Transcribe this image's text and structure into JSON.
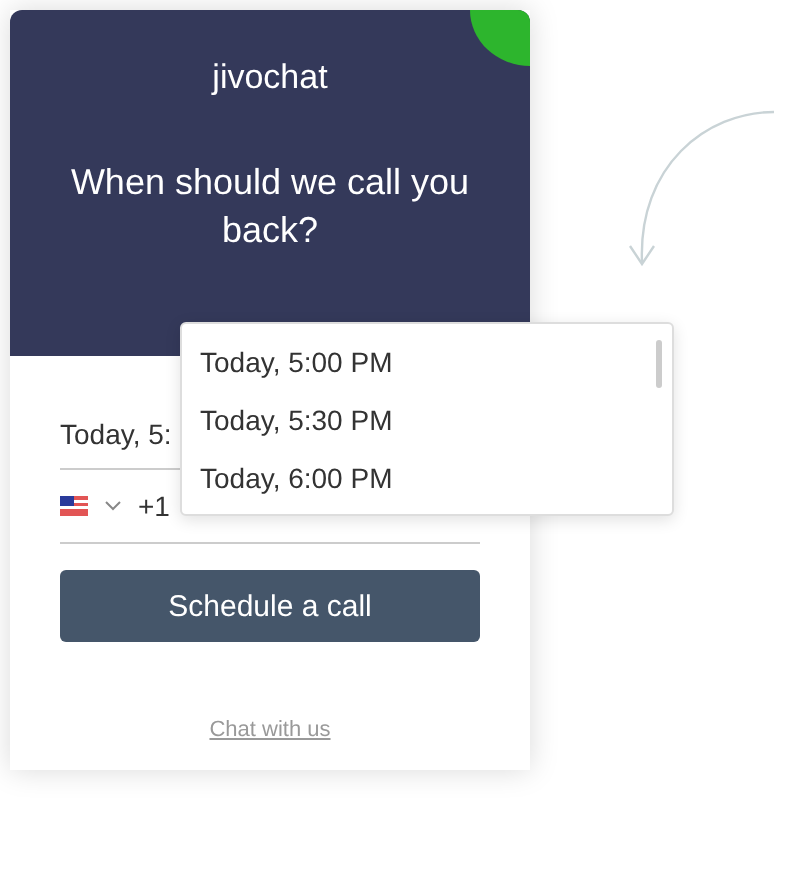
{
  "widget": {
    "logo": "jivochat",
    "heading": "When should we call you back?",
    "date_field": {
      "value": "Today, 5:"
    },
    "phone_field": {
      "code": "+1"
    },
    "submit_button": "Schedule a call",
    "link": "Chat with us"
  },
  "dropdown": {
    "options": [
      "Today, 5:00 PM",
      "Today, 5:30 PM",
      "Today, 6:00 PM"
    ]
  }
}
